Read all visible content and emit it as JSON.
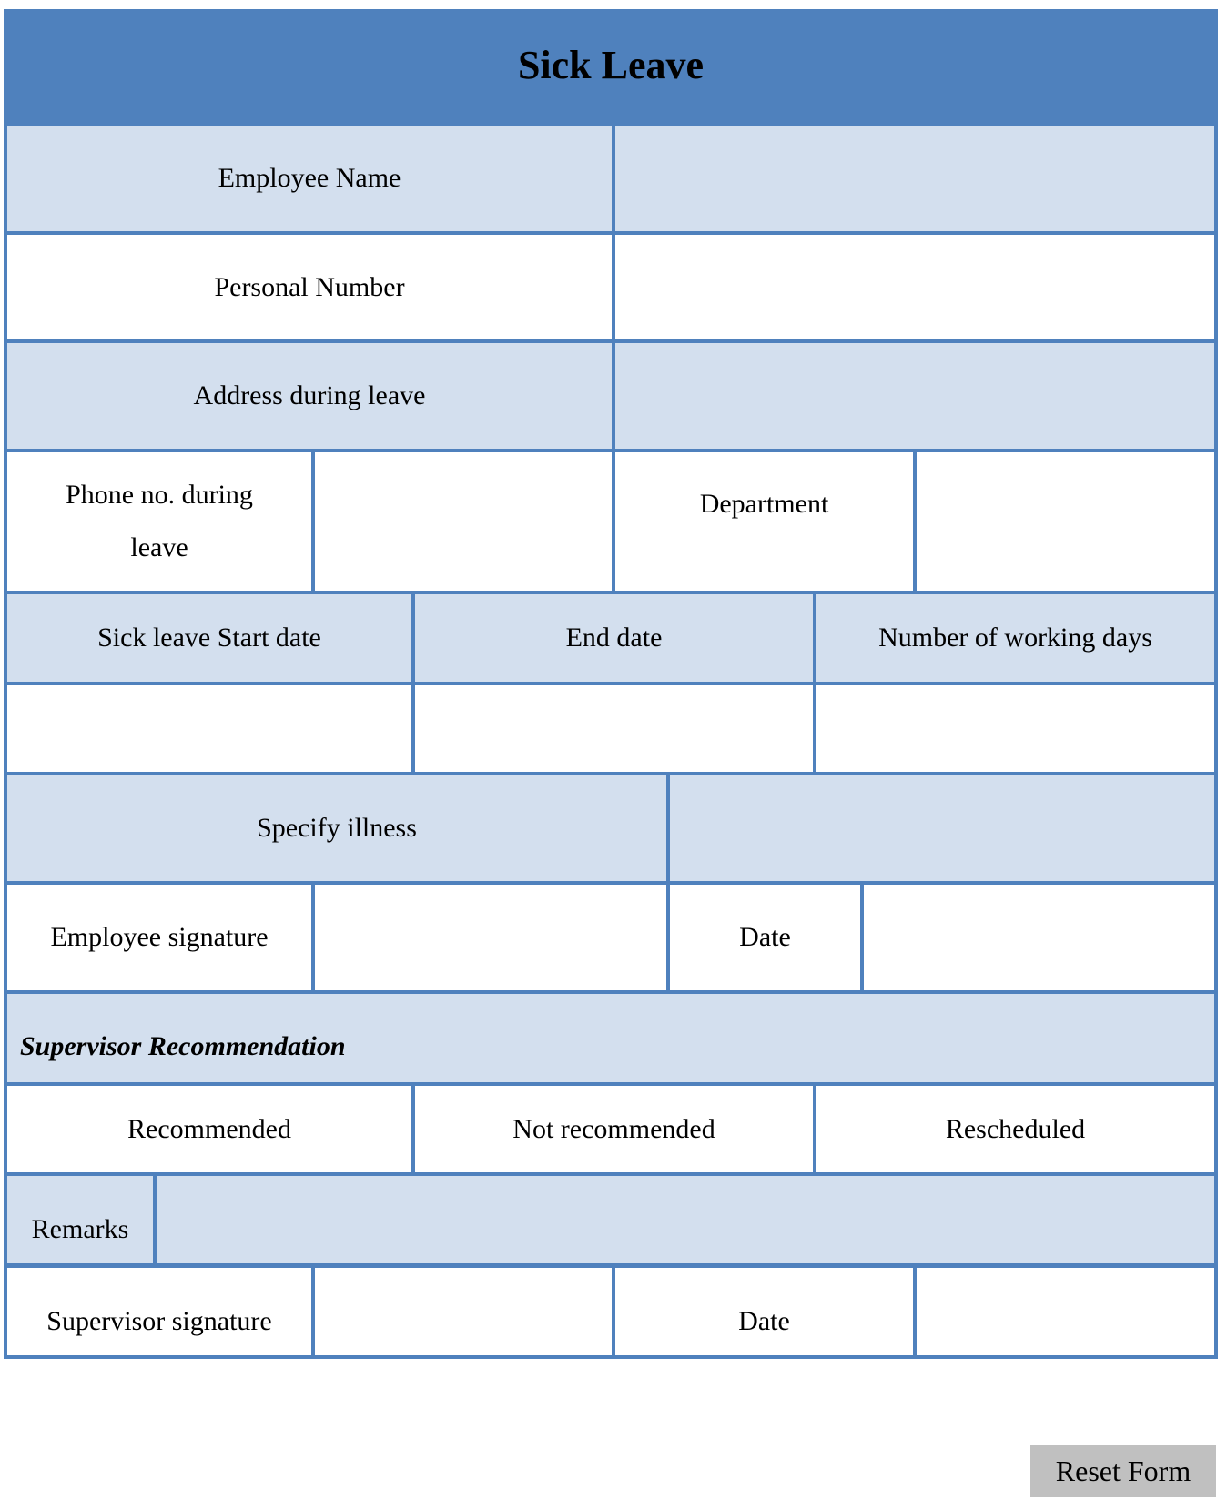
{
  "form": {
    "title": "Sick Leave",
    "labels": {
      "employee_name": "Employee Name",
      "personal_number": "Personal Number",
      "address_during_leave": "Address during leave",
      "phone_during_leave": "Phone no. during leave",
      "department": "Department",
      "start_date": "Sick leave Start date",
      "end_date": "End date",
      "working_days": "Number of working days",
      "specify_illness": "Specify illness",
      "employee_signature": "Employee signature",
      "employee_date": "Date",
      "supervisor_section": "Supervisor Recommendation",
      "recommended": "Recommended",
      "not_recommended": "Not recommended",
      "rescheduled": "Rescheduled",
      "remarks": "Remarks",
      "supervisor_signature": "Supervisor signature",
      "supervisor_date": "Date"
    },
    "values": {
      "employee_name": "",
      "personal_number": "",
      "address_during_leave": "",
      "phone_during_leave": "",
      "department": "",
      "start_date": "",
      "end_date": "",
      "working_days": "",
      "specify_illness": "",
      "employee_signature": "",
      "employee_date": "",
      "remarks": "",
      "supervisor_signature": "",
      "supervisor_date": ""
    }
  },
  "buttons": {
    "reset": "Reset Form"
  },
  "colors": {
    "header": "#4F81BD",
    "shade": "#D3DFEE",
    "button": "#C0C0C0"
  }
}
